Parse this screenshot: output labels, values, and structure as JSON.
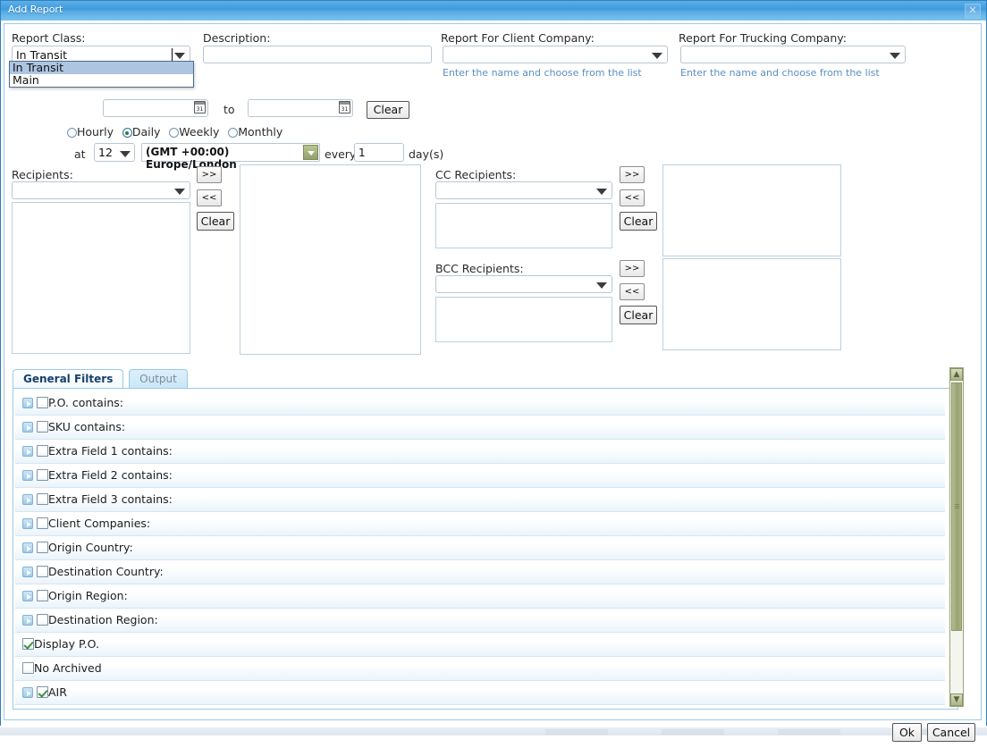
{
  "window": {
    "title": "Add Report",
    "close_icon": "close-icon"
  },
  "form": {
    "report_class": {
      "label": "Report Class:",
      "value": "In Transit",
      "options": [
        "In Transit",
        "Main"
      ],
      "selected_option": "In Transit",
      "dropdown_open": true
    },
    "description": {
      "label": "Description:",
      "value": "",
      "placeholder": ""
    },
    "report_for_client_company": {
      "label": "Report For Client Company:",
      "value": "",
      "hint": "Enter the name and choose from the list"
    },
    "report_for_trucking_company": {
      "label": "Report For Trucking Company:",
      "value": "",
      "hint": "Enter the name and choose from the list"
    },
    "date_range": {
      "from_value": "",
      "to_label": "to",
      "to_value": "",
      "clear_label": "Clear",
      "calendar_icon": "calendar-icon",
      "calendar_day": "31"
    },
    "frequency": {
      "options": [
        "Hourly",
        "Daily",
        "Weekly",
        "Monthly"
      ],
      "selected": "Daily"
    },
    "schedule": {
      "at_label": "at",
      "hour_value": "12",
      "timezone_value": "(GMT +00:00) Europe/London",
      "every_label": "every",
      "interval_value": "1",
      "unit_label": "day(s)"
    }
  },
  "recipients": {
    "main": {
      "label": "Recipients:",
      "combo_value": "",
      "add_label": ">>",
      "remove_label": "<<",
      "clear_label": "Clear",
      "selected_items": []
    },
    "cc": {
      "label": "CC Recipients:",
      "combo_value": "",
      "add_label": ">>",
      "remove_label": "<<",
      "clear_label": "Clear",
      "selected_items": []
    },
    "bcc": {
      "label": "BCC Recipients:",
      "combo_value": "",
      "add_label": ">>",
      "remove_label": "<<",
      "clear_label": "Clear",
      "selected_items": []
    }
  },
  "tabs": [
    {
      "label": "General Filters",
      "active": true
    },
    {
      "label": "Output",
      "active": false
    }
  ],
  "filters": [
    {
      "label": "P.O. contains:",
      "checked": false,
      "expandable": true
    },
    {
      "label": "SKU contains:",
      "checked": false,
      "expandable": true
    },
    {
      "label": "Extra Field 1 contains:",
      "checked": false,
      "expandable": true
    },
    {
      "label": "Extra Field 2 contains:",
      "checked": false,
      "expandable": true
    },
    {
      "label": "Extra Field 3 contains:",
      "checked": false,
      "expandable": true
    },
    {
      "label": "Client Companies:",
      "checked": false,
      "expandable": true
    },
    {
      "label": "Origin Country:",
      "checked": false,
      "expandable": true
    },
    {
      "label": "Destination Country:",
      "checked": false,
      "expandable": true
    },
    {
      "label": "Origin Region:",
      "checked": false,
      "expandable": true
    },
    {
      "label": "Destination Region:",
      "checked": false,
      "expandable": true
    },
    {
      "label": "Display P.O.",
      "checked": true,
      "expandable": false
    },
    {
      "label": "No Archived",
      "checked": false,
      "expandable": false
    },
    {
      "label": "AIR",
      "checked": true,
      "expandable": true
    }
  ],
  "scrollbar": {
    "up_icon": "chevron-up-icon",
    "down_icon": "chevron-down-icon"
  },
  "footer": {
    "ok_label": "Ok",
    "cancel_label": "Cancel"
  }
}
